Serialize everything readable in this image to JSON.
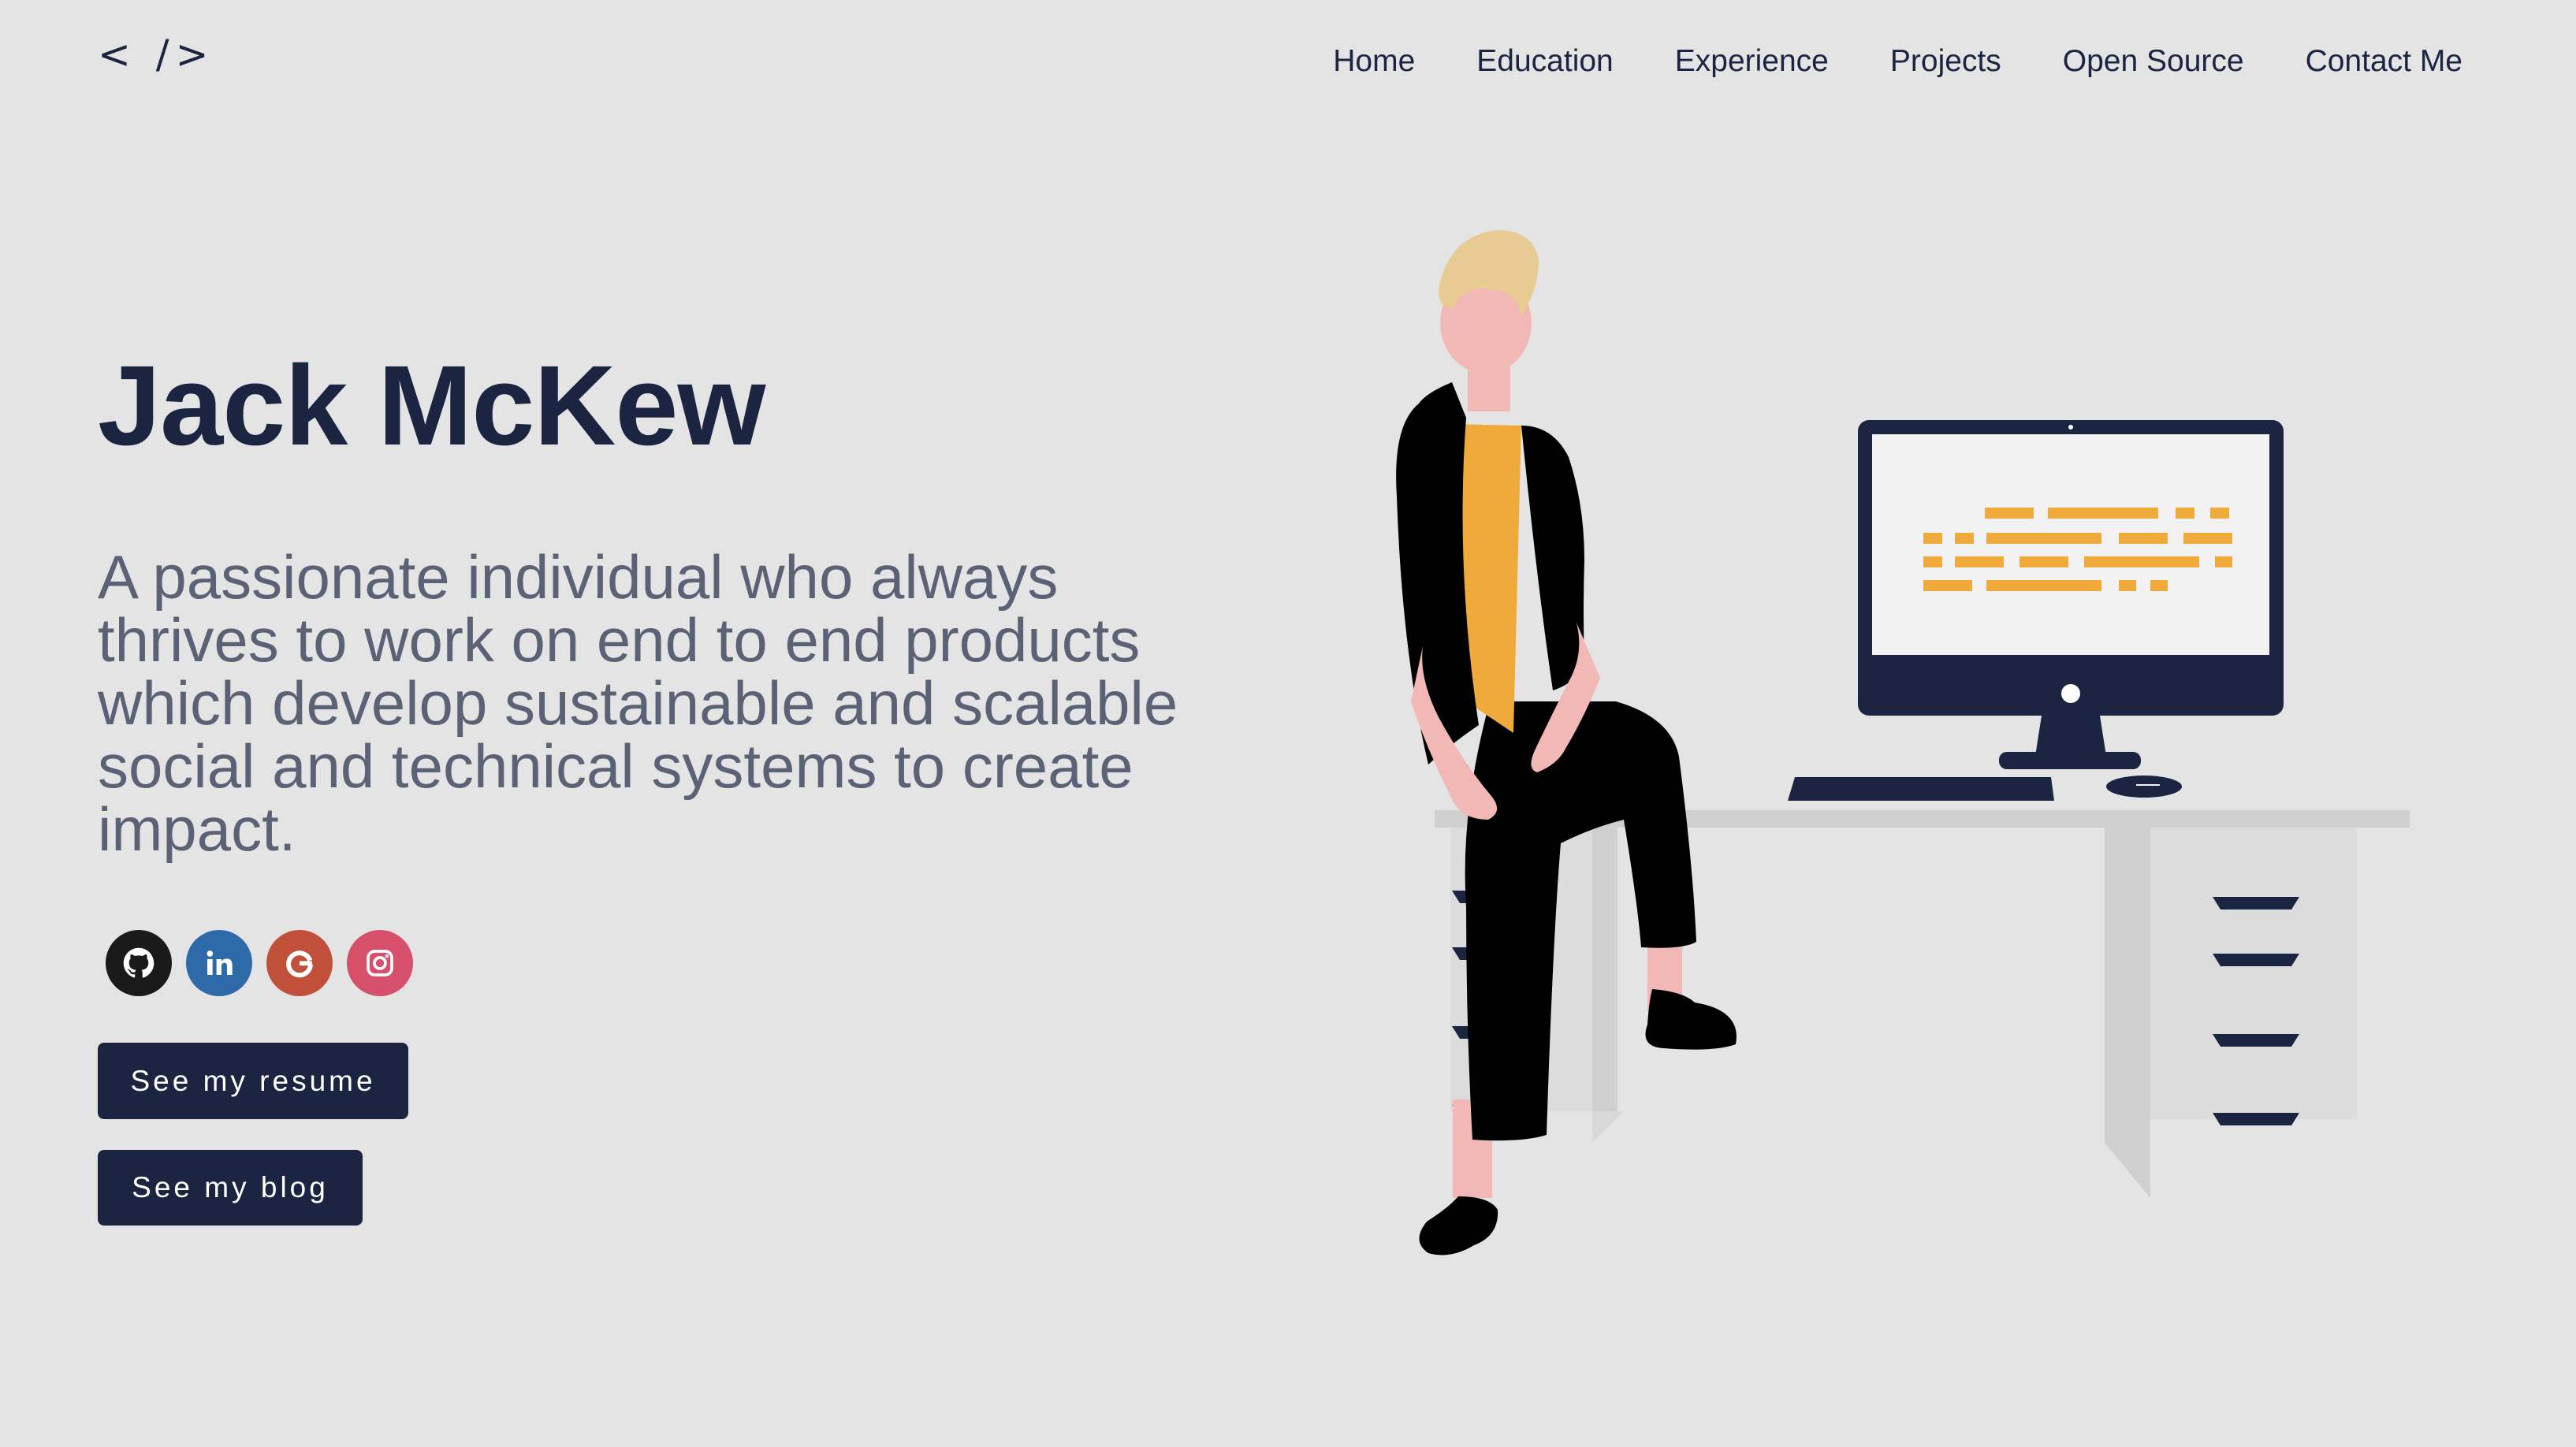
{
  "header": {
    "logo": "< />",
    "nav": [
      "Home",
      "Education",
      "Experience",
      "Projects",
      "Open Source",
      "Contact Me"
    ]
  },
  "hero": {
    "title": "Jack McKew",
    "subtitle": "A passionate individual who always thrives to work on end to end products which develop sustainable and scalable social and technical systems to create impact.",
    "socials": [
      {
        "name": "github",
        "icon": "github-icon",
        "color": "#1a1a1a"
      },
      {
        "name": "linkedin",
        "icon": "linkedin-icon",
        "color": "#2e6aa9"
      },
      {
        "name": "google",
        "icon": "google-icon",
        "color": "#c0503a"
      },
      {
        "name": "instagram",
        "icon": "instagram-icon",
        "color": "#d64f6b"
      }
    ],
    "resume_button": "See my resume",
    "blog_button": "See my blog"
  },
  "colors": {
    "background": "#e4e4e4",
    "primary": "#1b2440",
    "subtitle": "#5c6275",
    "accent": "#f0aa3c",
    "skin": "#f2b8b5",
    "hair": "#e8cb92"
  }
}
